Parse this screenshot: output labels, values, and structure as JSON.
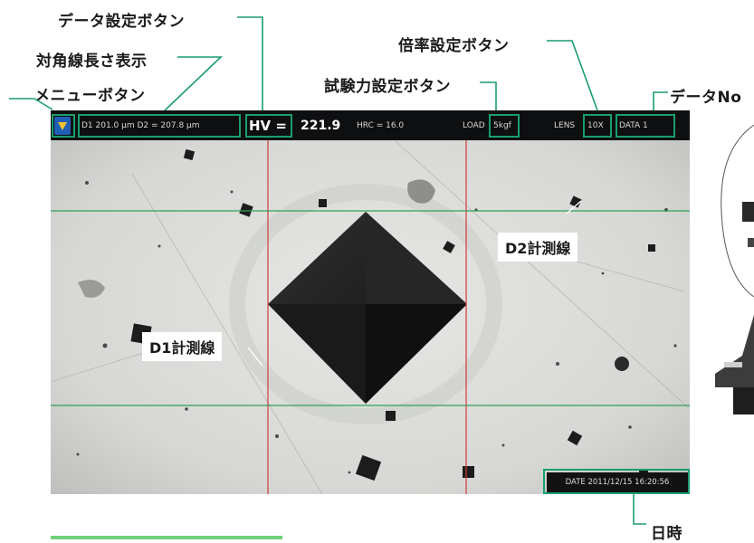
{
  "callouts": {
    "data_settings": "データ設定ボタン",
    "magnification_settings": "倍率設定ボタン",
    "diagonal_display": "対角線長さ表示",
    "test_force_settings": "試験力設定ボタン",
    "data_no": "データNo",
    "menu_button": "メニューボタン",
    "datetime": "日時"
  },
  "topbar": {
    "diagonals": "D1   201.0 μm  D2 = 207.8 μm",
    "hv_label": "HV =",
    "hv_value": "221.9",
    "hrc": "HRC =  16.0",
    "load_label": "LOAD",
    "load_value": "5kgf",
    "lens_label": "LENS",
    "lens_value": "10X",
    "data_label": "DATA  1"
  },
  "image_labels": {
    "d1_line": "D1計測線",
    "d2_line": "D2計測線"
  },
  "footer": {
    "datetime": "DATE  2011/12/15 16:20:56"
  },
  "colors": {
    "highlight": "#1a9e6e",
    "topbar_bg": "#0e0f11",
    "d1_lines": "#d23a3a",
    "d2_lines": "#2fa05a"
  }
}
